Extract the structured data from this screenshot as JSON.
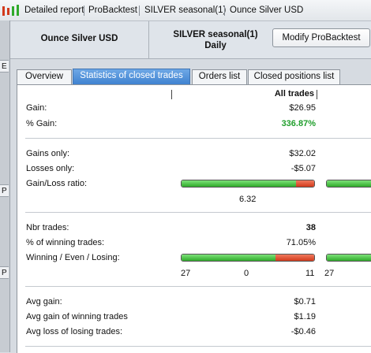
{
  "toolbar": {
    "items": [
      "Detailed report",
      "ProBacktest",
      "SILVER seasonal(1)",
      "Ounce Silver USD"
    ]
  },
  "left_strip": {
    "cells": [
      "E",
      "P",
      "P"
    ]
  },
  "header": {
    "instrument": "Ounce Silver USD",
    "system_name": "SILVER seasonal(1)",
    "period": "Daily",
    "modify_button": "Modify ProBacktest"
  },
  "tabs": [
    {
      "label": "Overview",
      "active": false
    },
    {
      "label": "Statistics of closed trades",
      "active": true
    },
    {
      "label": "Orders list",
      "active": false
    },
    {
      "label": "Closed positions list",
      "active": false
    }
  ],
  "stats": {
    "column_header": "All trades",
    "gain": {
      "label": "Gain:",
      "value": "$26.95"
    },
    "pct_gain": {
      "label": "% Gain:",
      "value": "336.87%"
    },
    "gains_only": {
      "label": "Gains only:",
      "value": "$32.02"
    },
    "losses_only": {
      "label": "Losses only:",
      "value": "-$5.07"
    },
    "gain_loss_ratio": {
      "label": "Gain/Loss ratio:",
      "value": "6.32",
      "bar_green_fraction": 0.863
    },
    "nbr_trades": {
      "label": "Nbr trades:",
      "value": "38"
    },
    "pct_winning": {
      "label": "% of winning trades:",
      "value": "71.05%"
    },
    "win_even_lose": {
      "label": "Winning / Even / Losing:",
      "winning": "27",
      "even": "0",
      "losing": "11",
      "bar_green_fraction": 0.7105
    },
    "second_column_value": "27",
    "avg_gain": {
      "label": "Avg gain:",
      "value": "$0.71"
    },
    "avg_gain_winning": {
      "label": "Avg gain of winning trades",
      "value": "$1.19"
    },
    "avg_loss_losing": {
      "label": "Avg loss of losing trades:",
      "value": "-$0.46"
    }
  },
  "colors": {
    "accent_tab": "#3f82d0",
    "positive_text": "#1f9e2b",
    "bar_green": "#2faa2a",
    "bar_red": "#d23a1c"
  }
}
